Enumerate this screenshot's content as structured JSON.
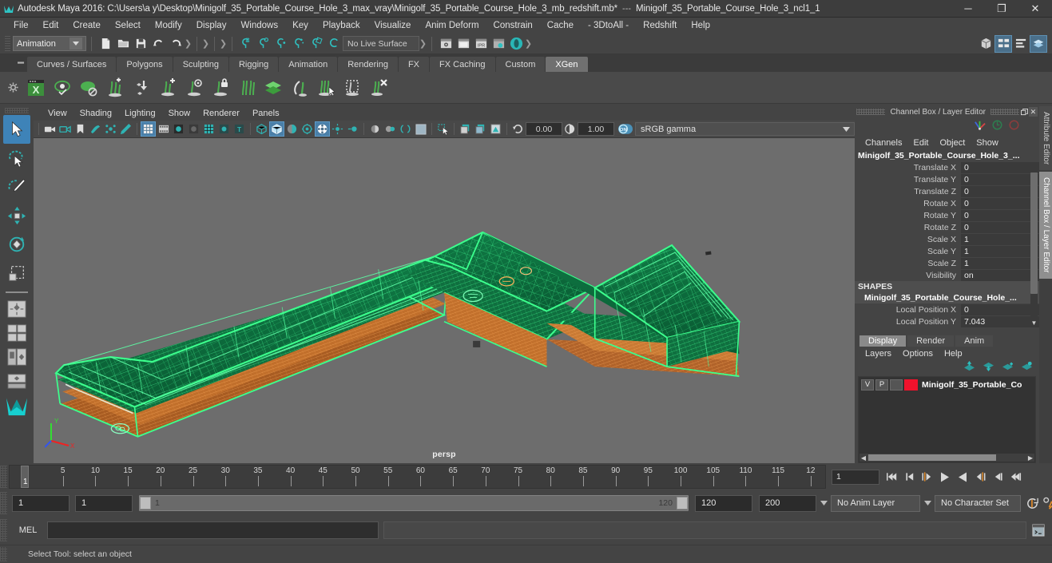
{
  "titlebar": {
    "app_title": "Autodesk Maya 2016: C:\\Users\\a y\\Desktop\\Minigolf_35_Portable_Course_Hole_3_max_vray\\Minigolf_35_Portable_Course_Hole_3_mb_redshift.mb*",
    "separator": "---",
    "selection_title": "Minigolf_35_Portable_Course_Hole_3_ncl1_1",
    "minimize": "─",
    "maximize": "❐",
    "close": "✕"
  },
  "menubar": {
    "items": [
      "File",
      "Edit",
      "Create",
      "Select",
      "Modify",
      "Display",
      "Windows",
      "Key",
      "Playback",
      "Visualize",
      "Anim Deform",
      "Constrain",
      "Cache",
      "- 3DtoAll -",
      "Redshift",
      "Help"
    ]
  },
  "statusbar": {
    "menu_set": "Animation",
    "live_surface": "No Live Surface"
  },
  "shelf": {
    "tabs": [
      "Curves / Surfaces",
      "Polygons",
      "Sculpting",
      "Rigging",
      "Animation",
      "Rendering",
      "FX",
      "FX Caching",
      "Custom",
      "XGen"
    ],
    "active_tab": "XGen",
    "icon_count": 14
  },
  "viewport": {
    "menus": [
      "View",
      "Shading",
      "Lighting",
      "Show",
      "Renderer",
      "Panels"
    ],
    "exposure": "0.00",
    "gamma": "1.00",
    "color_space": "sRGB gamma",
    "gamma_toggle": "ON",
    "camera_label": "persp",
    "background_color": "#6d6d6d",
    "wire_green": "#3bff8a",
    "wire_orange": "#d4762a",
    "axis": {
      "y": "Y",
      "x": "X",
      "z": "Z"
    }
  },
  "channelbox": {
    "panel_title": "Channel Box / Layer Editor",
    "menus": [
      "Channels",
      "Edit",
      "Object",
      "Show"
    ],
    "node_name": "Minigolf_35_Portable_Course_Hole_3_...",
    "channels": [
      {
        "label": "Translate X",
        "value": "0"
      },
      {
        "label": "Translate Y",
        "value": "0"
      },
      {
        "label": "Translate Z",
        "value": "0"
      },
      {
        "label": "Rotate X",
        "value": "0"
      },
      {
        "label": "Rotate Y",
        "value": "0"
      },
      {
        "label": "Rotate Z",
        "value": "0"
      },
      {
        "label": "Scale X",
        "value": "1"
      },
      {
        "label": "Scale Y",
        "value": "1"
      },
      {
        "label": "Scale Z",
        "value": "1"
      },
      {
        "label": "Visibility",
        "value": "on"
      }
    ],
    "shapes_header": "SHAPES",
    "shape_name": "Minigolf_35_Portable_Course_Hole_...",
    "shape_channels": [
      {
        "label": "Local Position X",
        "value": "0"
      },
      {
        "label": "Local Position Y",
        "value": "7.043"
      }
    ]
  },
  "dock_tabs": {
    "attribute_editor": "Attribute Editor",
    "channel_box": "Channel Box / Layer Editor",
    "active": "Channel Box / Layer Editor"
  },
  "layer_editor": {
    "tabs": [
      "Display",
      "Render",
      "Anim"
    ],
    "active_tab": "Display",
    "menus": [
      "Layers",
      "Options",
      "Help"
    ],
    "layers": [
      {
        "visibility": "V",
        "playback": "P",
        "shading": "",
        "color": "#f2122c",
        "name": "Minigolf_35_Portable_Co"
      }
    ]
  },
  "timeline": {
    "current_frame": "1",
    "frame_field": "1",
    "tick_labels": [
      "5",
      "10",
      "15",
      "20",
      "25",
      "30",
      "35",
      "40",
      "45",
      "50",
      "55",
      "60",
      "65",
      "70",
      "75",
      "80",
      "85",
      "90",
      "95",
      "100",
      "105",
      "110",
      "115",
      "12"
    ],
    "start": 1,
    "end": 120
  },
  "range": {
    "anim_start": "1",
    "range_start": "1",
    "bar_start_label": "1",
    "bar_end_label": "120",
    "range_end": "120",
    "anim_end": "200",
    "anim_layer": "No Anim Layer",
    "character_set": "No Character Set"
  },
  "command_line": {
    "language": "MEL",
    "input_value": "",
    "output_value": ""
  },
  "helpline": {
    "text": "Select Tool: select an object"
  },
  "colors": {
    "accent_blue": "#3e83b8",
    "teal": "#3bbfbf",
    "xgen_green": "#4caf50",
    "orange": "#e8801f",
    "panel_bg": "#444444",
    "viewport_bg": "#6d6d6d"
  }
}
